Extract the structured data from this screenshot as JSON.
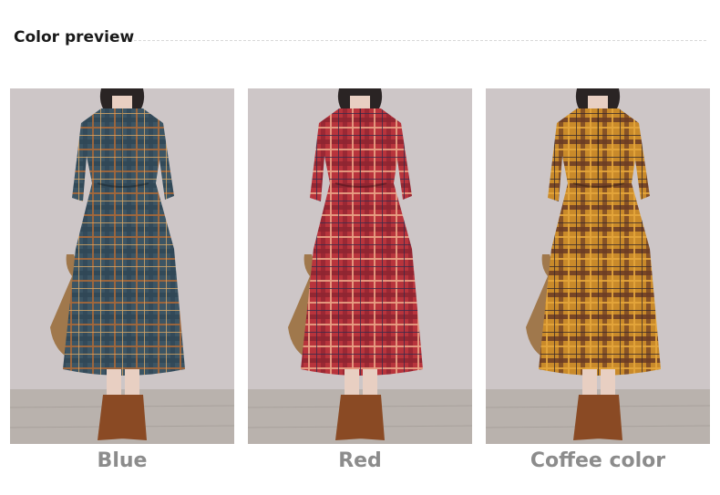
{
  "header": {
    "title": "Color preview"
  },
  "swatches": [
    {
      "label": "Blue",
      "base": "#3c5564",
      "stripe_a": "#2f4656",
      "stripe_b": "#a5683a",
      "stripe_c": "#d8a766"
    },
    {
      "label": "Red",
      "base": "#b8343c",
      "stripe_a": "#8e2430",
      "stripe_b": "#e9a184",
      "stripe_c": "#3a2a4a"
    },
    {
      "label": "Coffee color",
      "base": "#c98a2a",
      "stripe_a": "#6a3a24",
      "stripe_b": "#e5a63b",
      "stripe_c": "#3b2a2a"
    }
  ],
  "colors": {
    "wall": "#cdc6c7",
    "floor": "#b9b2ad",
    "skin": "#e8cfc2",
    "hair": "#2a2424",
    "bag": "#a0784c",
    "boot": "#8a4a24",
    "label_text": "#8c8c8c"
  }
}
